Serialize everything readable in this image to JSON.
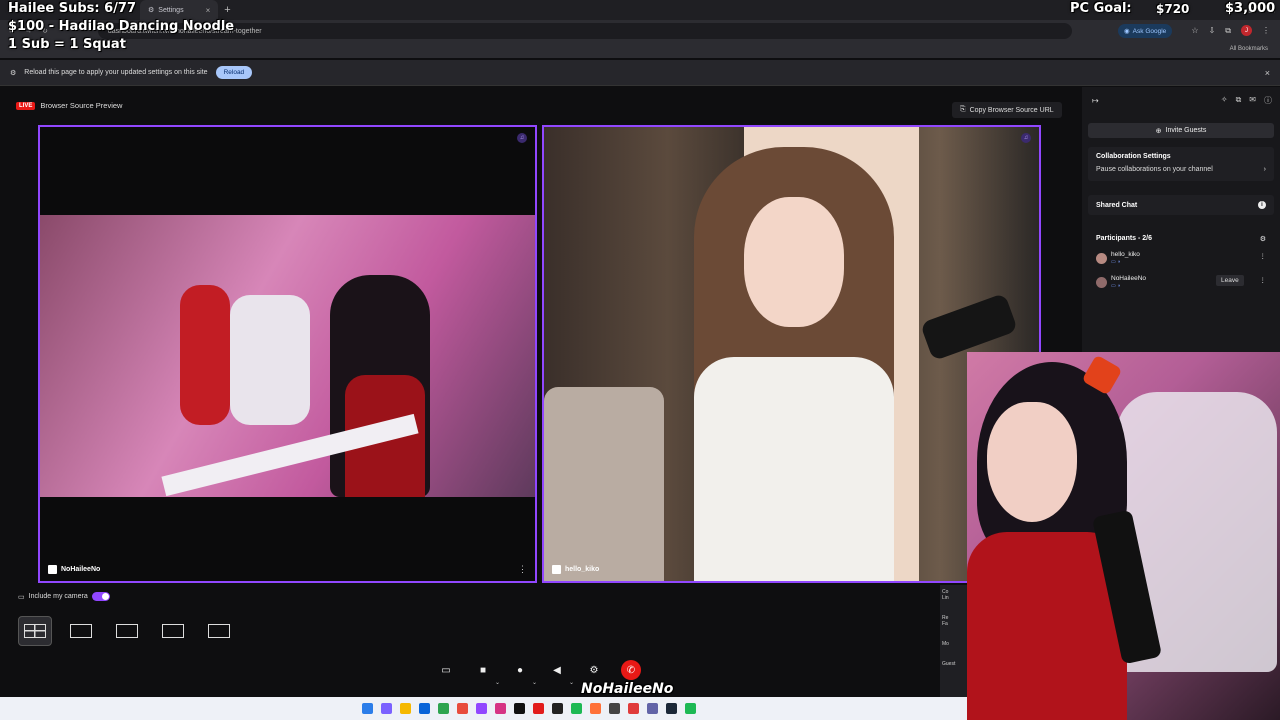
{
  "browser": {
    "tabs": [
      {
        "label": "Settings",
        "close": "×"
      }
    ],
    "new_tab": "+",
    "url": "dashboard.twitch.tv/u/nohaileeno/stream-together",
    "ask_google": "Ask Google",
    "all_bookmarks": "All Bookmarks",
    "window_controls": [
      "—",
      "☐",
      "✕"
    ]
  },
  "infobar": {
    "message": "Reload this page to apply your updated settings on this site",
    "reload": "Reload",
    "close": "×"
  },
  "overlay": {
    "subs": "Hailee Subs: 6/77",
    "goal_noodle": "$100 - Hadilao Dancing Noodle",
    "squat": "1 Sub = 1 Squat",
    "pc_goal_label": "PC Goal:",
    "pc_goal_current": "$720",
    "pc_goal_target": "$3,000",
    "streamer_name": "NoHaileeNo"
  },
  "preview": {
    "live": "LIVE",
    "title": "Browser Source Preview",
    "copy_url": "Copy Browser Source URL",
    "cams": [
      {
        "name": "NoHaileeNo"
      },
      {
        "name": "hello_kiko"
      }
    ],
    "include_camera": "Include my camera"
  },
  "panel": {
    "invite": "Invite Guests",
    "collab_title": "Collaboration Settings",
    "collab_sub": "Pause collaborations on your channel",
    "shared_chat": "Shared Chat",
    "participants": "Participants - 2/6",
    "people": [
      {
        "name": "hello_kiko"
      },
      {
        "name": "NoHaileeNo",
        "action": "Leave"
      }
    ]
  },
  "peek": {
    "items": [
      "Co",
      "Lin",
      "Re",
      "Fa",
      "Mo",
      "Guest"
    ]
  }
}
